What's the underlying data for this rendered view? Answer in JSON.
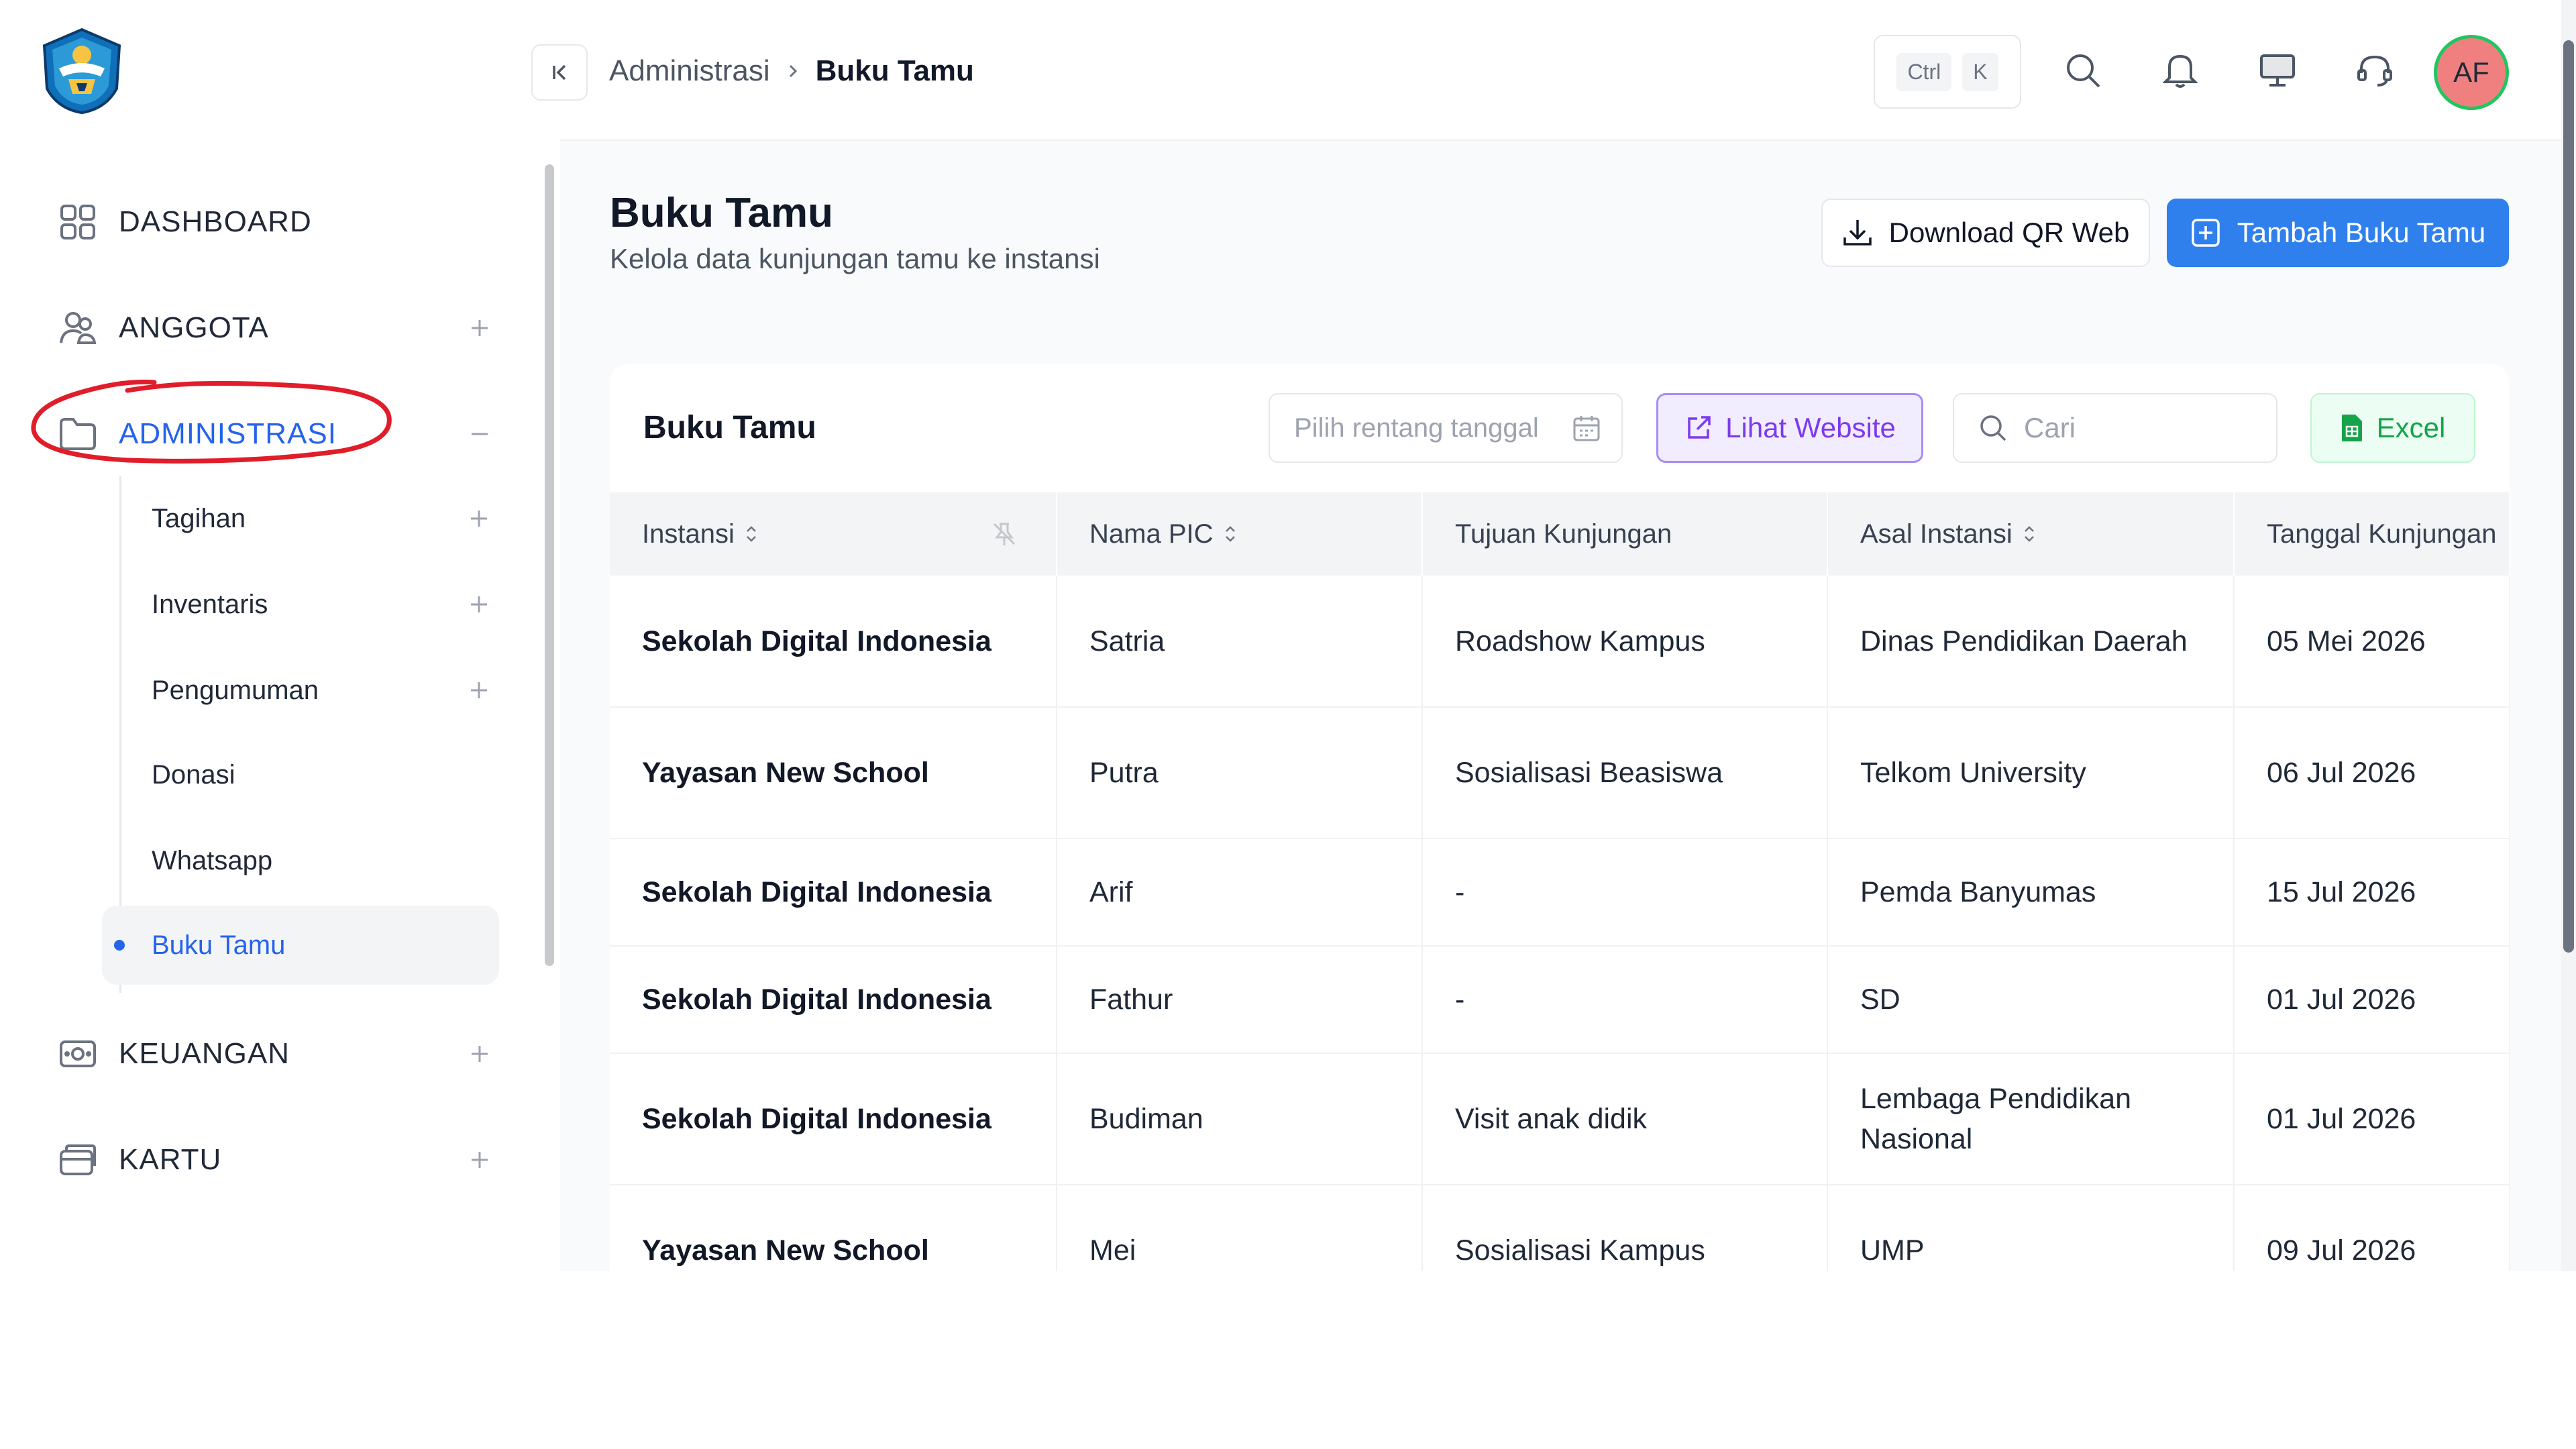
{
  "sidebar": {
    "logo": "kemendikbud-logo",
    "items": [
      {
        "label": "DASHBOARD",
        "icon": "grid-icon"
      },
      {
        "label": "ANGGOTA",
        "icon": "users-icon"
      },
      {
        "label": "ADMINISTRASI",
        "icon": "folder-icon",
        "active": true
      },
      {
        "label": "KEUANGAN",
        "icon": "money-icon"
      },
      {
        "label": "KARTU",
        "icon": "card-icon"
      }
    ],
    "submenu": [
      {
        "label": "Tagihan",
        "expandable": true
      },
      {
        "label": "Inventaris",
        "expandable": true
      },
      {
        "label": "Pengumuman",
        "expandable": true
      },
      {
        "label": "Donasi",
        "expandable": false
      },
      {
        "label": "Whatsapp",
        "expandable": false
      },
      {
        "label": "Buku Tamu",
        "expandable": false,
        "active": true
      }
    ]
  },
  "header": {
    "breadcrumb": [
      "Administrasi",
      "Buku Tamu"
    ],
    "shortcut": {
      "key1": "Ctrl",
      "key2": "K"
    },
    "avatar_initials": "AF"
  },
  "page": {
    "title": "Buku Tamu",
    "subtitle": "Kelola data kunjungan tamu ke instansi",
    "download_label": "Download QR Web",
    "add_label": "Tambah Buku Tamu"
  },
  "card": {
    "title": "Buku Tamu",
    "date_placeholder": "Pilih rentang tanggal",
    "website_label": "Lihat Website",
    "search_placeholder": "Cari",
    "excel_label": "Excel"
  },
  "table": {
    "columns": [
      "Instansi",
      "Nama PIC",
      "Tujuan Kunjungan",
      "Asal Instansi",
      "Tanggal Kunjungan"
    ],
    "rows": [
      {
        "instansi": "Sekolah Digital Indonesia",
        "pic": "Satria",
        "tujuan": "Roadshow Kampus",
        "asal": "Dinas Pendidikan Daerah",
        "tanggal": "05 Mei 2026"
      },
      {
        "instansi": "Yayasan New School",
        "pic": "Putra",
        "tujuan": "Sosialisasi Beasiswa",
        "asal": "Telkom University",
        "tanggal": "06 Jul 2026"
      },
      {
        "instansi": "Sekolah Digital Indonesia",
        "pic": "Arif",
        "tujuan": "-",
        "asal": "Pemda Banyumas",
        "tanggal": "15 Jul 2026"
      },
      {
        "instansi": "Sekolah Digital Indonesia",
        "pic": "Fathur",
        "tujuan": "-",
        "asal": "SD",
        "tanggal": "01 Jul 2026"
      },
      {
        "instansi": "Sekolah Digital Indonesia",
        "pic": "Budiman",
        "tujuan": "Visit anak didik",
        "asal": "Lembaga Pendidikan Nasional",
        "tanggal": "01 Jul 2026"
      },
      {
        "instansi": "Yayasan New School",
        "pic": "Mei",
        "tujuan": "Sosialisasi Kampus",
        "asal": "UMP",
        "tanggal": "09 Jul 2026"
      }
    ]
  },
  "colors": {
    "accent": "#2563eb",
    "primary_button": "#2f80ed",
    "website_button": "#7c3aed",
    "excel_button": "#16a34a",
    "annotation": "#e11d2a"
  }
}
